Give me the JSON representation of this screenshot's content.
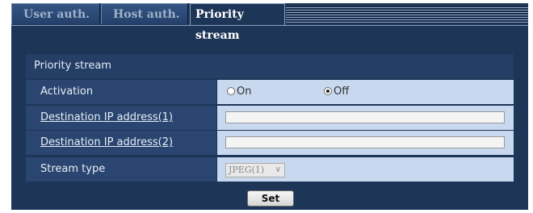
{
  "tabs": [
    {
      "label": "User auth.",
      "active": false
    },
    {
      "label": "Host auth.",
      "active": false
    },
    {
      "label": "Priority stream",
      "active": true
    }
  ],
  "section": {
    "title": "Priority stream"
  },
  "rows": {
    "activation": {
      "label": "Activation",
      "options": [
        "On",
        "Off"
      ],
      "selected": "Off"
    },
    "dest1": {
      "label": "Destination IP address(1)",
      "value": ""
    },
    "dest2": {
      "label": "Destination IP address(2)",
      "value": ""
    },
    "stream_type": {
      "label": "Stream type",
      "value": "JPEG(1)"
    }
  },
  "set_label": "Set",
  "colors": {
    "frame": "#1d3557",
    "label_bg": "#2a4570",
    "cell_bg": "#c8d8ee"
  }
}
